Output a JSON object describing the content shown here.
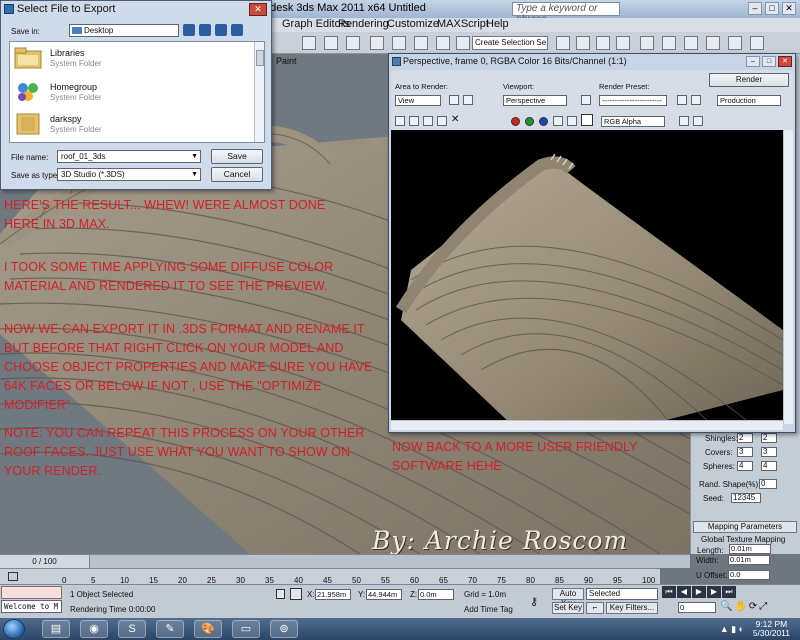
{
  "max_window": {
    "title": "odesk 3ds Max  2011 x64      Untitled",
    "search_placeholder": "Type a keyword or phrase"
  },
  "menubar": [
    "Graph Editors",
    "Rendering",
    "Customize",
    "MAXScript",
    "Help"
  ],
  "toolbar": {
    "selection_set": "Create Selection Se"
  },
  "viewport": {
    "paint_label": "Paint"
  },
  "export_dialog": {
    "title": "Select File to Export",
    "save_in_label": "Save in:",
    "save_in_value": "Desktop",
    "items": [
      {
        "name": "Libraries",
        "type": "System Folder"
      },
      {
        "name": "Homegroup",
        "type": "System Folder"
      },
      {
        "name": "darkspy",
        "type": "System Folder"
      }
    ],
    "file_name_label": "File name:",
    "file_name_value": "roof_01_3ds",
    "save_as_label": "Save as type:",
    "save_as_value": "3D Studio (*.3DS)",
    "save_button": "Save",
    "cancel_button": "Cancel"
  },
  "render_window": {
    "title": "Perspective, frame 0, RGBA Color 16 Bits/Channel (1:1)",
    "area_label": "Area to Render:",
    "area_value": "View",
    "viewport_label": "Viewport:",
    "viewport_value": "Perspective",
    "preset_label": "Render Preset:",
    "preset_value": "------------------------",
    "render_button": "Render",
    "production_value": "Production",
    "channel_value": "RGB Alpha",
    "channel_colors": [
      "#d62020",
      "#1a9a2a",
      "#1f3fc4"
    ]
  },
  "overlay_text": {
    "p1": "HERE'S THE RESULT... WHEW! WERE ALMOST DONE HERE IN 3D MAX.",
    "p2": "I TOOK SOME TIME APPLYING SOME DIFFUSE COLOR MATERIAL AND RENDERED IT TO SEE THE PREVIEW.",
    "p3": "NOW WE CAN EXPORT IT IN .3DS FORMAT AND RENAME IT BUT BEFORE THAT RIGHT CLICK ON YOUR MODEL AND CHOOSE OBJECT PROPERTIES AND MAKE SURE YOU HAVE 64K FACES OR BELOW IF NOT , USE THE \"OPTIMIZE MODIFIER\"",
    "p4": "NOTE: YOU CAN REPEAT THIS PROCESS ON YOUR OTHER ROOF FACES. JUST USE WHAT YOU WANT TO SHOW ON YOUR RENDER.",
    "p5": "NOW BACK TO A MORE USER FRIENDLY SOFTWARE HEHE",
    "color": "#d2202a"
  },
  "signature": "By: Archie Roscom",
  "command_panel": {
    "shingles_label": "Shingles:",
    "shingles_values": [
      "2",
      "2"
    ],
    "covers_label": "Covers:",
    "covers_values": [
      "3",
      "3"
    ],
    "spheres_label": "Spheres:",
    "spheres_values": [
      "4",
      "4"
    ],
    "rand_label": "Rand. Shape(%):",
    "rand_value": "0",
    "seed_label": "Seed:",
    "seed_value": "12345",
    "mapping_rollout": "Mapping Parameters",
    "global_mapping": "Global Texture Mapping",
    "length_label": "Length:",
    "length_value": "0.01m",
    "width_label": "Width:",
    "width_value": "0.01m",
    "uoffset_label": "U Offset:",
    "uoffset_value": "0.0"
  },
  "timeline": {
    "slider": "0 / 100",
    "ticks": [
      "0",
      "5",
      "10",
      "15",
      "20",
      "25",
      "30",
      "35",
      "40",
      "45",
      "50",
      "55",
      "60",
      "65",
      "70",
      "75",
      "80",
      "85",
      "90",
      "95",
      "100"
    ]
  },
  "status": {
    "listener": "Welcome to M",
    "selected": "1 Object Selected",
    "rendering_time": "Rendering Time  0:00:00",
    "x_label": "X:",
    "x_value": "21.958m",
    "y_label": "Y:",
    "y_value": "44.944m",
    "z_label": "Z:",
    "z_value": "0.0m",
    "grid": "Grid = 1.0m",
    "add_time_tag": "Add Time Tag",
    "auto_key": "Auto Key",
    "set_key": "Set Key",
    "selected_drop": "Selected",
    "key_filters": "Key Filters...",
    "frame_value": "0"
  },
  "taskbar": {
    "time": "9:12 PM",
    "date": "5/30/2011"
  }
}
